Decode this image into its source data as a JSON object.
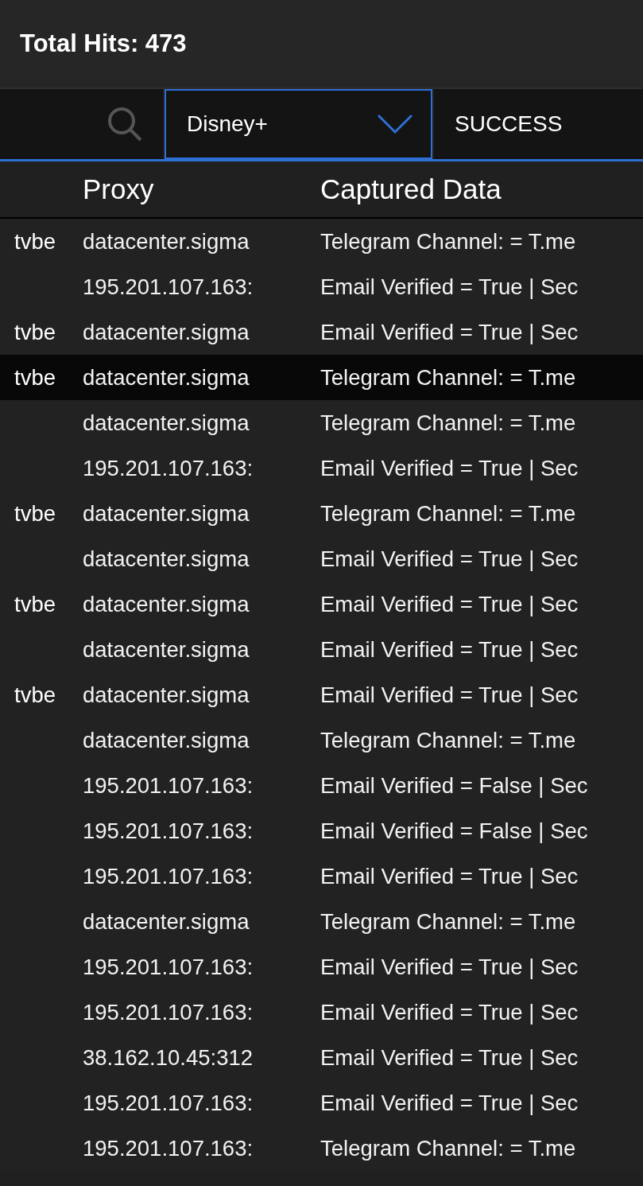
{
  "header": {
    "title": "Total Hits: 473"
  },
  "filters": {
    "service": "Disney+",
    "status": "SUCCESS"
  },
  "table": {
    "columns": [
      "Proxy",
      "Captured Data"
    ],
    "rows": [
      {
        "column_1": "tvbe",
        "proxy": "datacenter.sigma",
        "data": "Telegram Channel: = T.me",
        "selected": false
      },
      {
        "column_1": "",
        "proxy": "195.201.107.163:",
        "data": "Email Verified = True | Sec",
        "selected": false
      },
      {
        "column_1": "tvbe",
        "proxy": "datacenter.sigma",
        "data": "Email Verified = True | Sec",
        "selected": false
      },
      {
        "column_1": "tvbe",
        "proxy": "datacenter.sigma",
        "data": "Telegram Channel: = T.me",
        "selected": true
      },
      {
        "column_1": "",
        "proxy": "datacenter.sigma",
        "data": "Telegram Channel: = T.me",
        "selected": false
      },
      {
        "column_1": "",
        "proxy": "195.201.107.163:",
        "data": "Email Verified = True | Sec",
        "selected": false
      },
      {
        "column_1": "tvbe",
        "proxy": "datacenter.sigma",
        "data": "Telegram Channel: = T.me",
        "selected": false
      },
      {
        "column_1": "",
        "proxy": "datacenter.sigma",
        "data": "Email Verified = True | Sec",
        "selected": false
      },
      {
        "column_1": "tvbe",
        "proxy": "datacenter.sigma",
        "data": "Email Verified = True | Sec",
        "selected": false
      },
      {
        "column_1": "",
        "proxy": "datacenter.sigma",
        "data": "Email Verified = True | Sec",
        "selected": false
      },
      {
        "column_1": "tvbe",
        "proxy": "datacenter.sigma",
        "data": "Email Verified = True | Sec",
        "selected": false
      },
      {
        "column_1": "",
        "proxy": "datacenter.sigma",
        "data": "Telegram Channel: = T.me",
        "selected": false
      },
      {
        "column_1": "",
        "proxy": "195.201.107.163:",
        "data": "Email Verified = False | Sec",
        "selected": false
      },
      {
        "column_1": "",
        "proxy": "195.201.107.163:",
        "data": "Email Verified = False | Sec",
        "selected": false
      },
      {
        "column_1": "",
        "proxy": "195.201.107.163:",
        "data": "Email Verified = True | Sec",
        "selected": false
      },
      {
        "column_1": "",
        "proxy": "datacenter.sigma",
        "data": "Telegram Channel: = T.me",
        "selected": false
      },
      {
        "column_1": "",
        "proxy": "195.201.107.163:",
        "data": "Email Verified = True | Sec",
        "selected": false
      },
      {
        "column_1": "",
        "proxy": "195.201.107.163:",
        "data": "Email Verified = True | Sec",
        "selected": false
      },
      {
        "column_1": "",
        "proxy": "38.162.10.45:312",
        "data": "Email Verified = True | Sec",
        "selected": false
      },
      {
        "column_1": "",
        "proxy": "195.201.107.163:",
        "data": "Email Verified = True | Sec",
        "selected": false
      },
      {
        "column_1": "",
        "proxy": "195.201.107.163:",
        "data": "Telegram Channel: = T.me",
        "selected": false
      }
    ]
  }
}
